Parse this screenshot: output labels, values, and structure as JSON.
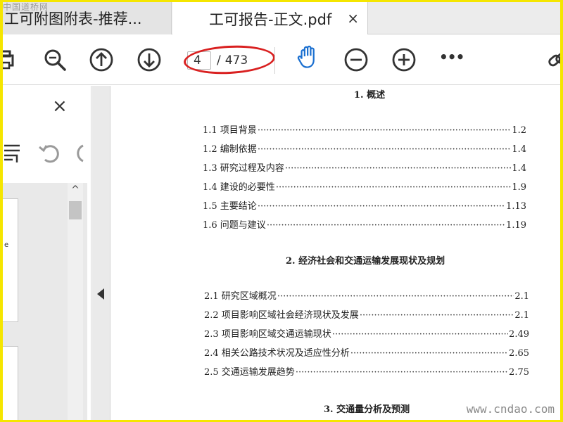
{
  "watermarks": {
    "top_left": "中国道桥网",
    "bottom_right": "www.cndao.com"
  },
  "tabs": [
    {
      "label": "工可附图附表-推荐...",
      "active": false
    },
    {
      "label": "工可报告-正文.pdf",
      "active": true,
      "close_symbol": "×"
    }
  ],
  "toolbar": {
    "page_current": "4",
    "page_separator": "/",
    "page_total": "473",
    "more_symbol": "•••"
  },
  "left_panel": {
    "close_symbol": "×",
    "scroll_up_symbol": "^"
  },
  "document": {
    "sections": [
      {
        "title": "1.  概述",
        "items": [
          {
            "label": "1.1 项目背景",
            "page": "1.2"
          },
          {
            "label": "1.2 编制依据",
            "page": "1.4"
          },
          {
            "label": "1.3 研究过程及内容",
            "page": "1.4"
          },
          {
            "label": "1.4 建设的必要性",
            "page": "1.9"
          },
          {
            "label": "1.5 主要结论",
            "page": "1.13"
          },
          {
            "label": "1.6 问题与建议",
            "page": "1.19"
          }
        ]
      },
      {
        "title": "2.   经济社会和交通运输发展现状及规划",
        "items": [
          {
            "label": "2.1 研究区域概况",
            "page": "2.1"
          },
          {
            "label": "2.2 项目影响区域社会经济现状及发展",
            "page": "2.1"
          },
          {
            "label": "2.3 项目影响区域交通运输现状",
            "page": "2.49"
          },
          {
            "label": "2.4 相关公路技术状况及适应性分析",
            "page": "2.65"
          },
          {
            "label": "2.5 交通运输发展趋势",
            "page": "2.75"
          }
        ]
      },
      {
        "title": "3.   交通量分析及预测",
        "items": []
      }
    ]
  },
  "colors": {
    "frame": "#f5e600",
    "annotation_circle": "#d92020",
    "hand_tool": "#1a6fd0"
  }
}
